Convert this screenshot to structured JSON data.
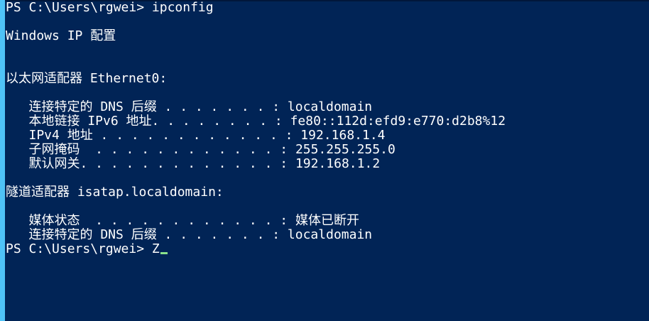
{
  "lines": [
    "PS C:\\Users\\rgwei> ipconfig",
    "",
    "Windows IP 配置",
    "",
    "",
    "以太网适配器 Ethernet0:",
    "",
    "   连接特定的 DNS 后缀 . . . . . . . : localdomain",
    "   本地链接 IPv6 地址. . . . . . . . : fe80::112d:efd9:e770:d2b8%12",
    "   IPv4 地址 . . . . . . . . . . . . : 192.168.1.4",
    "   子网掩码  . . . . . . . . . . . . : 255.255.255.0",
    "   默认网关. . . . . . . . . . . . . : 192.168.1.2",
    "",
    "隧道适配器 isatap.localdomain:",
    "",
    "   媒体状态  . . . . . . . . . . . . : 媒体已断开",
    "   连接特定的 DNS 后缀 . . . . . . . : localdomain"
  ],
  "prompt": {
    "text": "PS C:\\Users\\rgwei> ",
    "input": "Z"
  },
  "colors": {
    "background": "#012456",
    "text": "#FFFFFF",
    "cursor": "#8BE28B",
    "window_edge": "#4FC3F7"
  }
}
